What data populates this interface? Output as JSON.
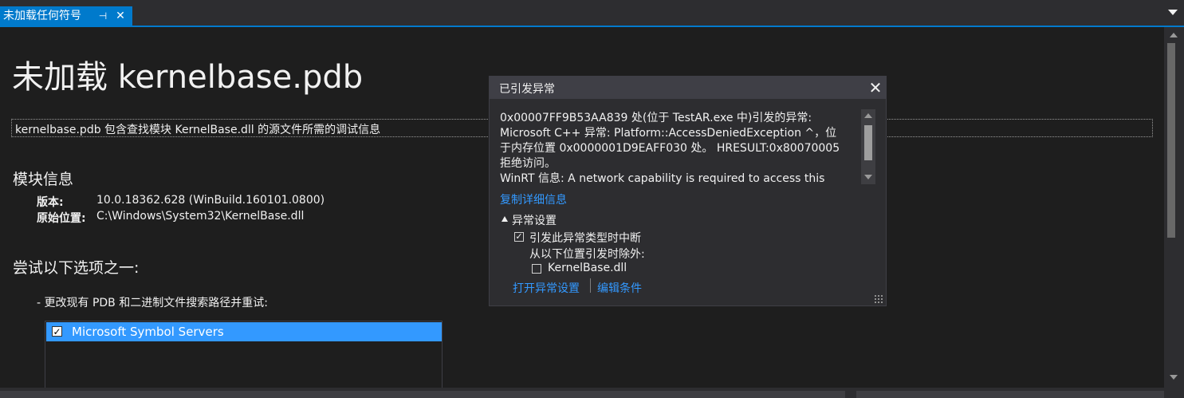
{
  "tab": {
    "label": "未加载任何符号",
    "pin_icon": "pin-icon",
    "close_icon": "close-icon"
  },
  "document": {
    "title": "未加载 kernelbase.pdb",
    "description": "kernelbase.pdb 包含查找模块 KernelBase.dll 的源文件所需的调试信息",
    "module_section": "模块信息",
    "version_label": "版本:",
    "version_value": "10.0.18362.628 (WinBuild.160101.0800)",
    "location_label": "原始位置:",
    "location_value": "C:\\Windows\\System32\\KernelBase.dll",
    "options_section": "尝试以下选项之一:",
    "option_1": "- 更改现有 PDB 和二进制文件搜索路径并重试:",
    "symbol_servers": [
      {
        "label": "Microsoft Symbol Servers",
        "checked": true,
        "selected": true
      }
    ]
  },
  "exception_popup": {
    "title": "已引发异常",
    "message_lines": [
      "0x00007FF9B53AA839 处(位于 TestAR.exe 中)引发的异常:",
      "Microsoft C++ 异常: Platform::AccessDeniedException ^，位",
      "于内存位置 0x0000001D9EAFF030 处。 HRESULT:0x80070005",
      "拒绝访问。",
      "WinRT 信息: A network capability is required to access this"
    ],
    "copy_details_link": "复制详细信息",
    "exception_settings_header": "异常设置",
    "break_checkbox_label": "引发此异常类型时中断",
    "break_checked": true,
    "except_label": "从以下位置引发时除外:",
    "kernelbase_checkbox_label": "KernelBase.dll",
    "kernelbase_checked": false,
    "open_settings_link": "打开异常设置",
    "edit_conditions_link": "编辑条件"
  },
  "colors": {
    "accent": "#007acc",
    "link": "#3399ff",
    "selection": "#3399ff",
    "background": "#1e1e1e"
  }
}
